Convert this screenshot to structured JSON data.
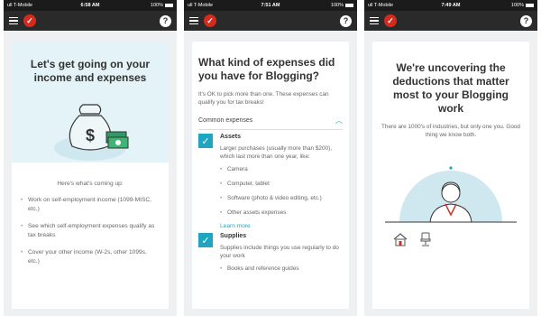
{
  "screens": [
    {
      "status": {
        "carrier": "ull T-Mobile",
        "time": "6:58 AM",
        "battery": "100%"
      },
      "title": "Let's get going on your income and expenses",
      "intro": "Here's what's coming up:",
      "bullets": [
        "Work on self-employment income (1099-MISC, etc.)",
        "See which self-employment expenses qualify as tax breaks",
        "Cover your other income (W-2s, other 1099s, etc.)"
      ]
    },
    {
      "status": {
        "carrier": "ull T-Mobile",
        "time": "7:51 AM",
        "battery": "100%"
      },
      "title": "What kind of expenses did you have for Blogging?",
      "subtitle": "It's OK to pick more than one. These expenses can qualify you for tax breaks!",
      "section_label": "Common expenses",
      "groups": [
        {
          "title": "Assets",
          "description": "Larger purchases (usually more than $200), which last more than one year, like:",
          "items": [
            "Camera",
            "Computer, tablet",
            "Software (photo & video editing, etc.)",
            "Other assets expenses"
          ]
        },
        {
          "title": "Supplies",
          "description": "Supplies include things you use regularly to do your work",
          "items": [
            "Books and reference guides"
          ]
        }
      ],
      "learn_more": "Learn more"
    },
    {
      "status": {
        "carrier": "ull T-Mobile",
        "time": "7:49 AM",
        "battery": "100%"
      },
      "title": "We're uncovering the deductions that matter most to your Blogging work",
      "subtitle": "There are 1000's of industries, but only one you. Good thing we know both."
    }
  ],
  "colors": {
    "accent": "#20a5c0",
    "brand_red": "#d52b1e",
    "navbar": "#2a2a2a",
    "banner": "#e3f3f8"
  },
  "icons": {
    "menu": "hamburger-icon",
    "logo": "checkmark-logo",
    "help": "help-icon",
    "checkbox": "checkmark-icon"
  }
}
